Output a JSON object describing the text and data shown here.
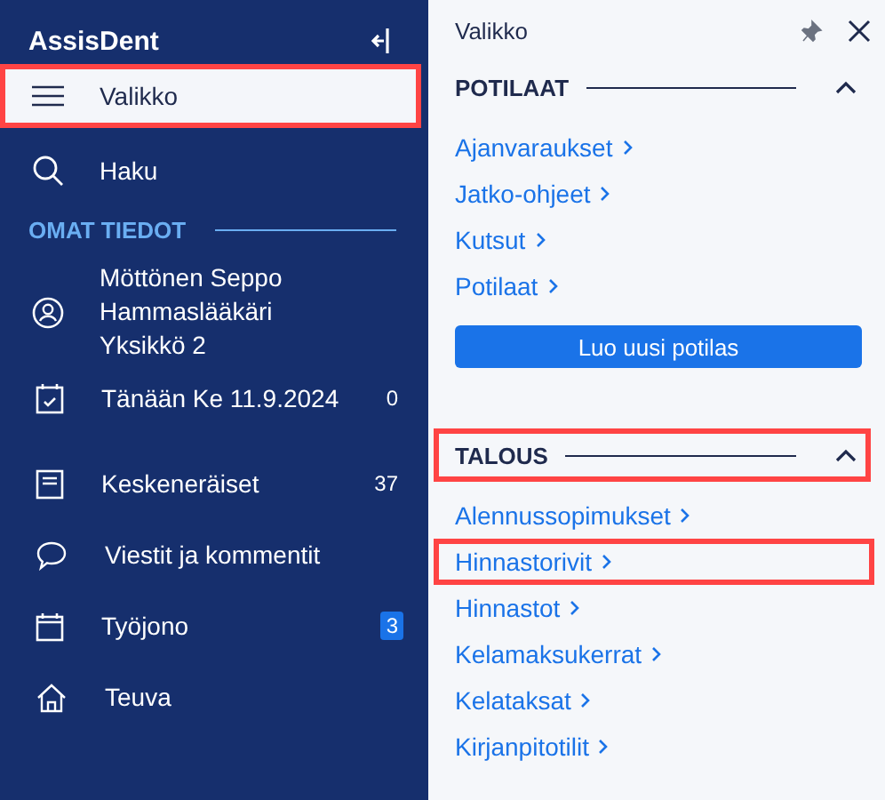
{
  "sidebar": {
    "brand": "AssisDent",
    "nav": [
      {
        "label": "Valikko",
        "selected": true,
        "highlighted": true
      },
      {
        "label": "Haku",
        "selected": false,
        "highlighted": false
      }
    ],
    "section_title": "OMAT TIEDOT",
    "profile": [
      "Möttönen Seppo",
      "Hammaslääkäri",
      "Yksikkö 2"
    ],
    "items": [
      {
        "label": "Tänään Ke 11.9.2024",
        "count": "0",
        "badge": false
      },
      {
        "label": "Keskeneräiset",
        "count": "37",
        "badge": false
      },
      {
        "label": "Viestit ja kommentit"
      },
      {
        "label": "Työjono",
        "count": "3",
        "badge": true
      },
      {
        "label": "Teuva"
      }
    ]
  },
  "panel": {
    "title": "Valikko",
    "sections": [
      {
        "title": "POTILAAT",
        "expanded": true,
        "highlighted": false,
        "links": [
          {
            "label": "Ajanvaraukset",
            "highlighted": false
          },
          {
            "label": "Jatko-ohjeet",
            "highlighted": false
          },
          {
            "label": "Kutsut",
            "highlighted": false
          },
          {
            "label": "Potilaat",
            "highlighted": false
          }
        ],
        "button": "Luo uusi potilas"
      },
      {
        "title": "TALOUS",
        "expanded": true,
        "highlighted": true,
        "links": [
          {
            "label": "Alennussopimukset",
            "highlighted": false
          },
          {
            "label": "Hinnastorivit",
            "highlighted": true
          },
          {
            "label": "Hinnastot",
            "highlighted": false
          },
          {
            "label": "Kelamaksukerrat",
            "highlighted": false
          },
          {
            "label": "Kelataksat",
            "highlighted": false
          },
          {
            "label": "Kirjanpitotilit",
            "highlighted": false
          }
        ]
      }
    ]
  }
}
